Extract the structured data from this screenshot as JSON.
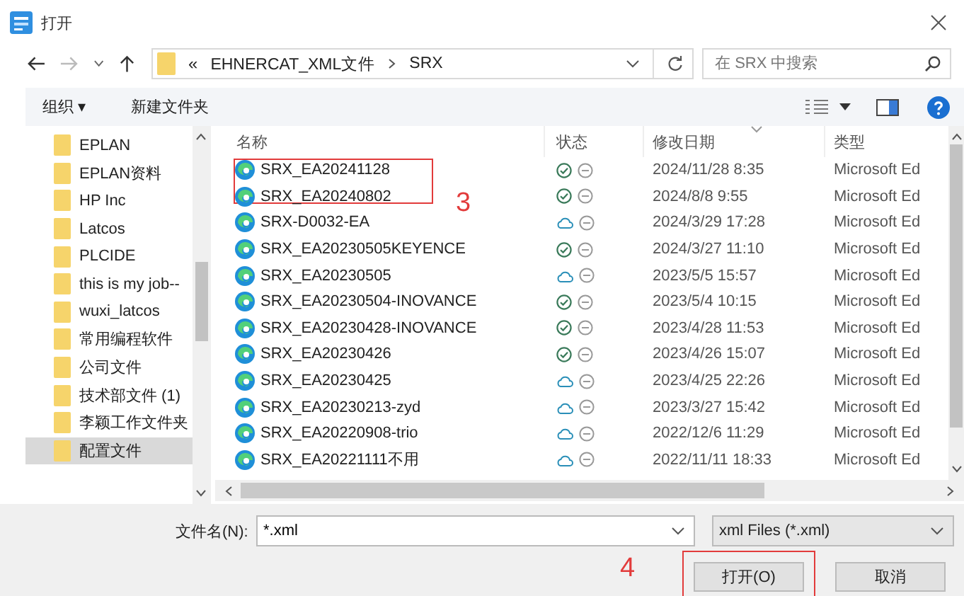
{
  "window": {
    "title": "打开"
  },
  "address": {
    "overflow": "«",
    "segments": [
      "EHNERCAT_XML文件",
      "SRX"
    ]
  },
  "search": {
    "placeholder": "在 SRX 中搜索"
  },
  "toolbar": {
    "organize": "组织 ▾",
    "new_folder": "新建文件夹"
  },
  "nav": {
    "items": [
      {
        "label": "EPLAN",
        "selected": false
      },
      {
        "label": "EPLAN资料",
        "selected": false
      },
      {
        "label": "HP Inc",
        "selected": false
      },
      {
        "label": "Latcos",
        "selected": false
      },
      {
        "label": "PLCIDE",
        "selected": false
      },
      {
        "label": "this is my job--",
        "selected": false
      },
      {
        "label": "wuxi_latcos",
        "selected": false
      },
      {
        "label": "常用编程软件",
        "selected": false
      },
      {
        "label": "公司文件",
        "selected": false
      },
      {
        "label": "技术部文件 (1)",
        "selected": false
      },
      {
        "label": "李颖工作文件夹",
        "selected": false
      },
      {
        "label": "配置文件",
        "selected": true
      }
    ]
  },
  "table": {
    "columns": [
      "名称",
      "状态",
      "修改日期",
      "类型"
    ],
    "rows": [
      {
        "name": "SRX_EA20241128",
        "kind": "synced",
        "date": "2024/11/28 8:35",
        "type": "Microsoft Ed"
      },
      {
        "name": "SRX_EA20240802",
        "kind": "synced",
        "date": "2024/8/8 9:55",
        "type": "Microsoft Ed"
      },
      {
        "name": "SRX-D0032-EA",
        "kind": "cloud",
        "date": "2024/3/29 17:28",
        "type": "Microsoft Ed"
      },
      {
        "name": "SRX_EA20230505KEYENCE",
        "kind": "synced",
        "date": "2024/3/27 11:10",
        "type": "Microsoft Ed"
      },
      {
        "name": "SRX_EA20230505",
        "kind": "cloud",
        "date": "2023/5/5 15:57",
        "type": "Microsoft Ed"
      },
      {
        "name": "SRX_EA20230504-INOVANCE",
        "kind": "synced",
        "date": "2023/5/4 10:15",
        "type": "Microsoft Ed"
      },
      {
        "name": "SRX_EA20230428-INOVANCE",
        "kind": "synced",
        "date": "2023/4/28 11:53",
        "type": "Microsoft Ed"
      },
      {
        "name": "SRX_EA20230426",
        "kind": "synced",
        "date": "2023/4/26 15:07",
        "type": "Microsoft Ed"
      },
      {
        "name": "SRX_EA20230425",
        "kind": "cloud",
        "date": "2023/4/25 22:26",
        "type": "Microsoft Ed"
      },
      {
        "name": "SRX_EA20230213-zyd",
        "kind": "cloud",
        "date": "2023/3/27 15:42",
        "type": "Microsoft Ed"
      },
      {
        "name": "SRX_EA20220908-trio",
        "kind": "cloud",
        "date": "2022/12/6 11:29",
        "type": "Microsoft Ed"
      },
      {
        "name": "SRX_EA20221111不用",
        "kind": "cloud",
        "date": "2022/11/11 18:33",
        "type": "Microsoft Ed"
      }
    ]
  },
  "filename": {
    "label": "文件名(N):",
    "value": "*.xml"
  },
  "filetype": {
    "value": "xml Files (*.xml)"
  },
  "buttons": {
    "open": "打开(O)",
    "cancel": "取消"
  },
  "annotations": [
    "3",
    "4"
  ]
}
